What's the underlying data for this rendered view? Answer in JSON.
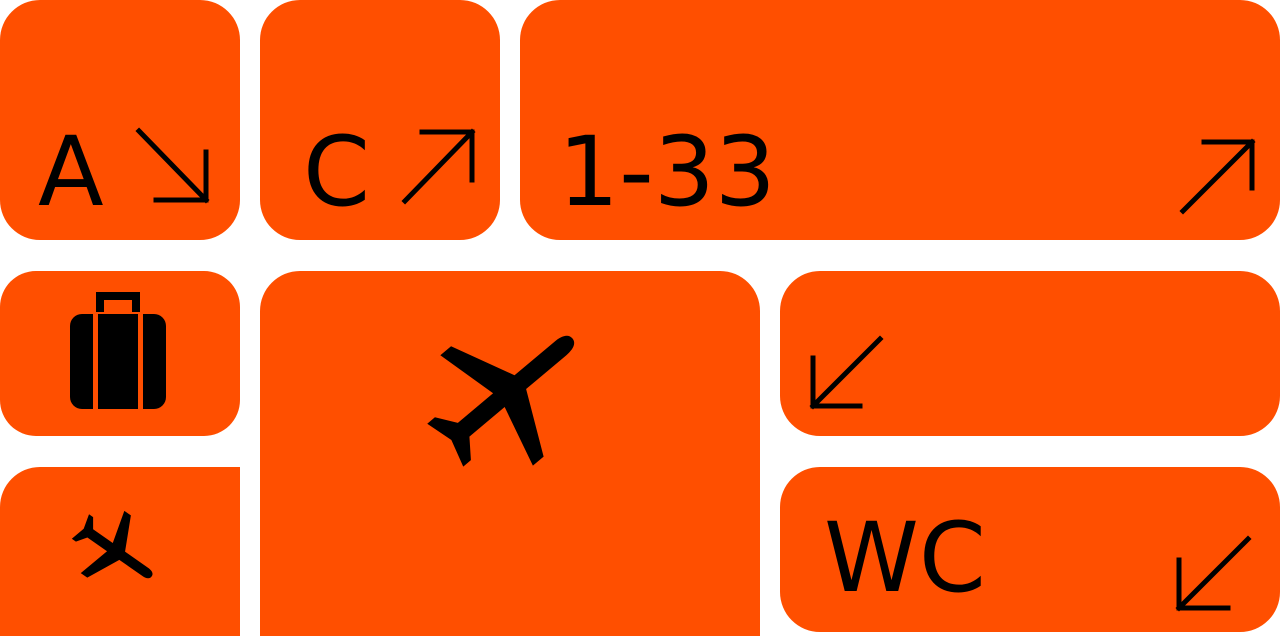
{
  "signage": {
    "colors": {
      "tile": "#ff4f00",
      "ink": "#000000",
      "background": "#ffffff"
    },
    "tiles": {
      "terminal_a": {
        "label": "A",
        "arrow": "arrow-down-right-icon"
      },
      "terminal_c": {
        "label": "C",
        "arrow": "arrow-up-right-icon"
      },
      "gates": {
        "label": "1-33",
        "arrow": "arrow-up-right-icon"
      },
      "baggage": {
        "icon": "baggage-icon"
      },
      "departures": {
        "icon": "airplane-icon"
      },
      "down_left": {
        "arrow": "arrow-down-left-icon"
      },
      "arrivals": {
        "icon": "airplane-landing-icon"
      },
      "restroom": {
        "label": "WC",
        "arrow": "arrow-down-left-icon"
      }
    }
  }
}
